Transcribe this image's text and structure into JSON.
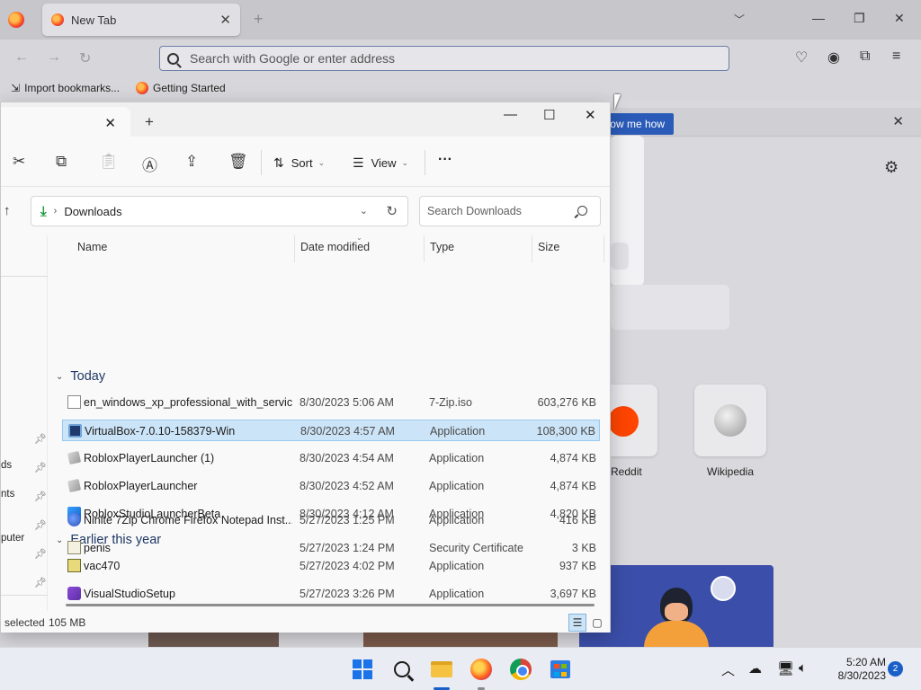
{
  "firefox": {
    "tab_title": "New Tab",
    "new_tab": "+",
    "tab_list": "⌄",
    "url_placeholder": "Search with Google or enter address",
    "bookmarks": [
      {
        "label": "Import bookmarks...",
        "icon": "import-icon"
      },
      {
        "label": "Getting Started",
        "icon": "firefox-icon"
      }
    ],
    "notice_button": "ow me how",
    "sites": [
      {
        "label": "Reddit",
        "icon": "reddit-icon"
      },
      {
        "label": "Wikipedia",
        "icon": "wikipedia-icon"
      }
    ],
    "colors": {
      "accent": "#2a5bb8",
      "pocket_bg": "#3b4faa"
    }
  },
  "explorer": {
    "new_tab": "+",
    "toolbar": {
      "sort_label": "Sort",
      "view_label": "View",
      "more_label": "···"
    },
    "address": {
      "location": "Downloads",
      "search_placeholder": "Search Downloads"
    },
    "nav": [
      {
        "label": "",
        "pinned": true
      },
      {
        "label": "ds",
        "pinned": true
      },
      {
        "label": "nts",
        "pinned": true
      },
      {
        "label": "",
        "pinned": true
      },
      {
        "label": "",
        "pinned": true
      },
      {
        "label": "",
        "pinned": true
      },
      {
        "label": "puter",
        "pinned": false
      }
    ],
    "columns": [
      "Name",
      "Date modified",
      "Type",
      "Size"
    ],
    "groups": [
      {
        "label": "Today",
        "files": [
          {
            "name": "en_windows_xp_professional_with_servic...",
            "date": "8/30/2023 5:06 AM",
            "type": "7-Zip.iso",
            "size": "603,276 KB",
            "icon": "iso-file-icon",
            "selected": false
          },
          {
            "name": "VirtualBox-7.0.10-158379-Win",
            "date": "8/30/2023 4:57 AM",
            "type": "Application",
            "size": "108,300 KB",
            "icon": "virtualbox-icon",
            "selected": true
          },
          {
            "name": "RobloxPlayerLauncher (1)",
            "date": "8/30/2023 4:54 AM",
            "type": "Application",
            "size": "4,874 KB",
            "icon": "roblox-icon",
            "selected": false
          },
          {
            "name": "RobloxPlayerLauncher",
            "date": "8/30/2023 4:52 AM",
            "type": "Application",
            "size": "4,874 KB",
            "icon": "roblox-icon",
            "selected": false
          },
          {
            "name": "RobloxStudioLauncherBeta",
            "date": "8/30/2023 4:12 AM",
            "type": "Application",
            "size": "4,820 KB",
            "icon": "roblox-studio-icon",
            "selected": false
          }
        ]
      },
      {
        "label": "Earlier this year",
        "files": [
          {
            "name": "vac470",
            "date": "5/27/2023 4:02 PM",
            "type": "Application",
            "size": "937 KB",
            "icon": "installer-icon",
            "selected": false
          },
          {
            "name": "VisualStudioSetup",
            "date": "5/27/2023 3:26 PM",
            "type": "Application",
            "size": "3,697 KB",
            "icon": "visual-studio-icon",
            "selected": false
          },
          {
            "name": "Ninite 7Zip Chrome Firefox Notepad Inst...",
            "date": "5/27/2023 1:25 PM",
            "type": "Application",
            "size": "416 KB",
            "icon": "ninite-icon",
            "selected": false
          },
          {
            "name": "penis",
            "date": "5/27/2023 1:24 PM",
            "type": "Security Certificate",
            "size": "3 KB",
            "icon": "certificate-icon",
            "selected": false
          }
        ]
      }
    ],
    "status": {
      "selected": "selected",
      "size": "105 MB"
    }
  },
  "taskbar": {
    "time": "5:20 AM",
    "date": "8/30/2023",
    "notifications": "2",
    "apps": [
      "start-icon",
      "search-icon",
      "file-explorer-icon",
      "firefox-icon",
      "chrome-icon",
      "store-icon"
    ]
  }
}
